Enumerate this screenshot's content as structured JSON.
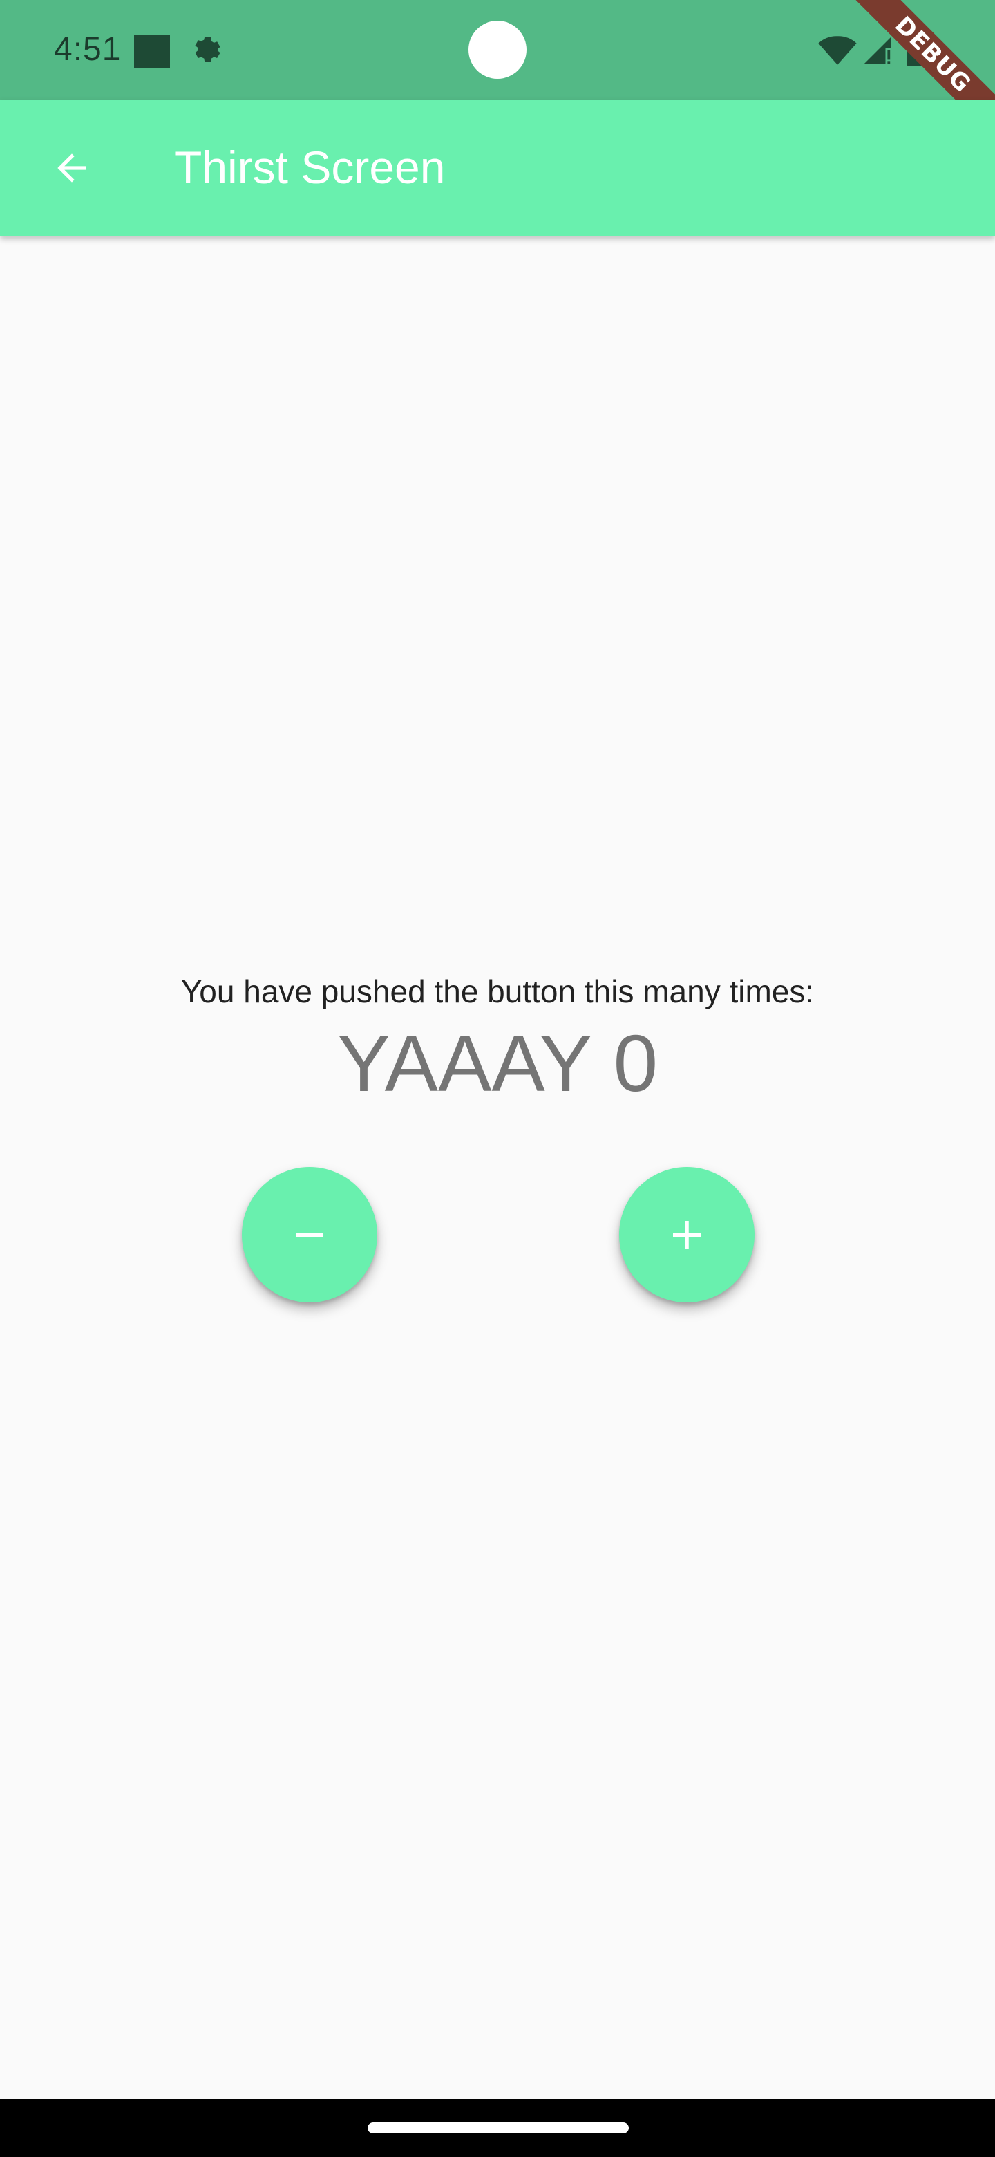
{
  "status_bar": {
    "time": "4:51",
    "icons": [
      "notification-square-icon",
      "settings-gear-icon",
      "wifi-icon",
      "cell-signal-icon",
      "battery-icon"
    ]
  },
  "debug_banner": {
    "label": "DEBUG"
  },
  "app_bar": {
    "title": "Thirst Screen",
    "back_icon": "arrow-back-icon",
    "background_color": "#69f0ae"
  },
  "counter": {
    "label": "You have pushed the button this many times:",
    "value": "YAAAY 0"
  },
  "actions": {
    "decrement_icon": "minus-icon",
    "increment_icon": "plus-icon",
    "fab_color": "#69f0ae"
  },
  "colors": {
    "status_bar": "#53b986",
    "background": "#fafafa",
    "accent": "#69f0ae",
    "debug_ribbon": "#7a3b2e"
  }
}
